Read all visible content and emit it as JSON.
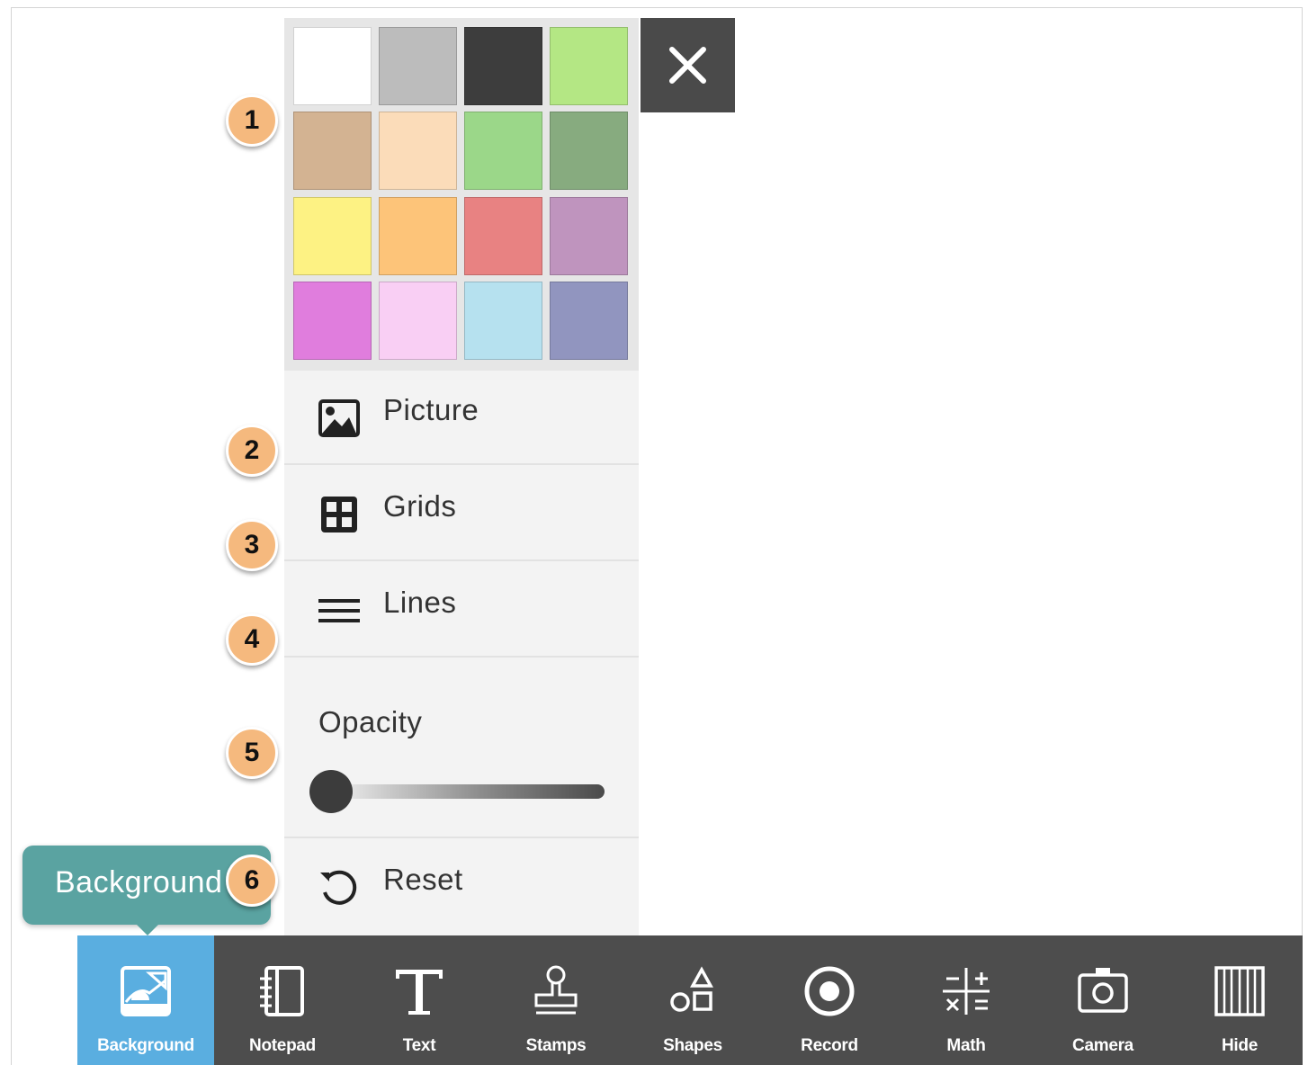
{
  "swatches": [
    "#ffffff",
    "#bcbcbc",
    "#3d3d3d",
    "#b4e784",
    "#d3b392",
    "#fbdcb9",
    "#9bd789",
    "#87ab7f",
    "#fdf283",
    "#fdc479",
    "#e88282",
    "#bf94be",
    "#e07ddd",
    "#f9cff4",
    "#b6e1ef",
    "#9195bf"
  ],
  "menu": {
    "picture_label": "Picture",
    "grids_label": "Grids",
    "lines_label": "Lines",
    "opacity_label": "Opacity",
    "opacity_value": 0,
    "reset_label": "Reset"
  },
  "badges": [
    "1",
    "2",
    "3",
    "4",
    "5",
    "6"
  ],
  "tooltip": {
    "text": "Background"
  },
  "toolbar": {
    "items": [
      {
        "label": "Background",
        "icon": "background-icon"
      },
      {
        "label": "Notepad",
        "icon": "notepad-icon"
      },
      {
        "label": "Text",
        "icon": "text-icon"
      },
      {
        "label": "Stamps",
        "icon": "stamp-icon"
      },
      {
        "label": "Shapes",
        "icon": "shapes-icon"
      },
      {
        "label": "Record",
        "icon": "record-icon"
      },
      {
        "label": "Math",
        "icon": "math-icon"
      },
      {
        "label": "Camera",
        "icon": "camera-icon"
      },
      {
        "label": "Hide",
        "icon": "hide-icon"
      }
    ],
    "active_color": "#5aaee0",
    "bar_color": "#4d4d4d"
  }
}
